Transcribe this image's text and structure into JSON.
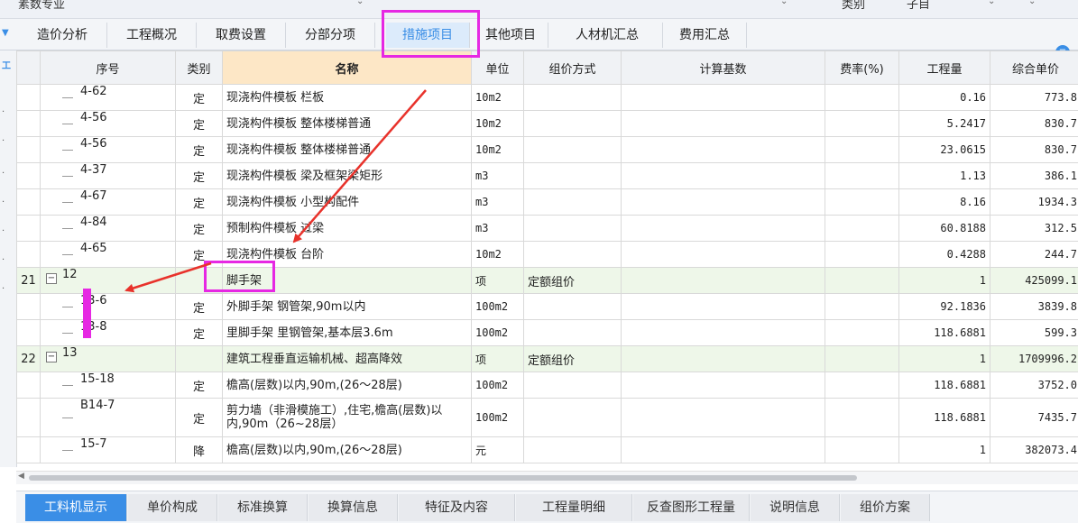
{
  "topbar": {
    "left": "素数专业",
    "mid": "类别",
    "right": "子目"
  },
  "tabs": [
    {
      "label": "造价分析"
    },
    {
      "label": "工程概况"
    },
    {
      "label": "取费设置"
    },
    {
      "label": "分部分项"
    },
    {
      "label": "措施项目"
    },
    {
      "label": "其他项目"
    },
    {
      "label": "人材机汇总"
    },
    {
      "label": "费用汇总"
    }
  ],
  "active_tab": "措施项目",
  "info_icon": "info-icon",
  "headers": [
    "序号",
    "类别",
    "名称",
    "单位",
    "组价方式",
    "计算基数",
    "费率(%)",
    "工程量",
    "综合单价"
  ],
  "rows": [
    {
      "idx": "",
      "code": "4-62",
      "type": "定",
      "name": "现浇构件模板 栏板",
      "unit": "10m2",
      "method": "",
      "base": "",
      "rate": "",
      "qty": "0.16",
      "price": "773.8"
    },
    {
      "idx": "",
      "code": "4-56",
      "type": "定",
      "name": "现浇构件模板 整体楼梯普通",
      "unit": "10m2",
      "method": "",
      "base": "",
      "rate": "",
      "qty": "5.2417",
      "price": "830.7"
    },
    {
      "idx": "",
      "code": "4-56",
      "type": "定",
      "name": "现浇构件模板 整体楼梯普通",
      "unit": "10m2",
      "method": "",
      "base": "",
      "rate": "",
      "qty": "23.0615",
      "price": "830.7"
    },
    {
      "idx": "",
      "code": "4-37",
      "type": "定",
      "name": "现浇构件模板 梁及框架梁矩形",
      "unit": "m3",
      "method": "",
      "base": "",
      "rate": "",
      "qty": "1.13",
      "price": "386.1"
    },
    {
      "idx": "",
      "code": "4-67",
      "type": "定",
      "name": "现浇构件模板 小型构配件",
      "unit": "m3",
      "method": "",
      "base": "",
      "rate": "",
      "qty": "8.16",
      "price": "1934.3"
    },
    {
      "idx": "",
      "code": "4-84",
      "type": "定",
      "name": "预制构件模板 过梁",
      "unit": "m3",
      "method": "",
      "base": "",
      "rate": "",
      "qty": "60.8188",
      "price": "312.5"
    },
    {
      "idx": "",
      "code": "4-65",
      "type": "定",
      "name": "现浇构件模板 台阶",
      "unit": "10m2",
      "method": "",
      "base": "",
      "rate": "",
      "qty": "0.4288",
      "price": "244.7"
    },
    {
      "idx": "21",
      "code": "12",
      "type": "",
      "name": "脚手架",
      "unit": "项",
      "method": "定额组价",
      "base": "",
      "rate": "",
      "qty": "1",
      "price": "425099.1",
      "group": true
    },
    {
      "idx": "",
      "code": "13-6",
      "type": "定",
      "name": "外脚手架 钢管架,90m以内",
      "unit": "100m2",
      "method": "",
      "base": "",
      "rate": "",
      "qty": "92.1836",
      "price": "3839.8"
    },
    {
      "idx": "",
      "code": "13-8",
      "type": "定",
      "name": "里脚手架 里钢管架,基本层3.6m",
      "unit": "100m2",
      "method": "",
      "base": "",
      "rate": "",
      "qty": "118.6881",
      "price": "599.3"
    },
    {
      "idx": "22",
      "code": "13",
      "type": "",
      "name": "建筑工程垂直运输机械、超高降效",
      "unit": "项",
      "method": "定额组价",
      "base": "",
      "rate": "",
      "qty": "1",
      "price": "1709996.2",
      "group": true
    },
    {
      "idx": "",
      "code": "15-18",
      "type": "定",
      "name": "檐高(层数)以内,90m,(26～28层)",
      "unit": "100m2",
      "method": "",
      "base": "",
      "rate": "",
      "qty": "118.6881",
      "price": "3752.0"
    },
    {
      "idx": "",
      "code": "B14-7",
      "type": "定",
      "name": "剪力墙（非滑模施工）,住宅,檐高(层数)以内,90m（26~28层）",
      "unit": "100m2",
      "method": "",
      "base": "",
      "rate": "",
      "qty": "118.6881",
      "price": "7435.7",
      "tall": true
    },
    {
      "idx": "",
      "code": "15-7",
      "type": "降",
      "name": "檐高(层数)以内,90m,(26～28层)",
      "unit": "元",
      "method": "",
      "base": "",
      "rate": "",
      "qty": "1",
      "price": "382073.4"
    }
  ],
  "bottom_tabs": [
    {
      "label": "工料机显示"
    },
    {
      "label": "单价构成"
    },
    {
      "label": "标准换算"
    },
    {
      "label": "换算信息"
    },
    {
      "label": "特征及内容"
    },
    {
      "label": "工程量明细"
    },
    {
      "label": "反查图形工程量"
    },
    {
      "label": "说明信息"
    },
    {
      "label": "组价方案"
    }
  ],
  "active_bottom_tab": "工料机显示",
  "colors": {
    "accent": "#3a8ee6",
    "annotation": "#e628e3",
    "arrow": "#e8322b",
    "group_row": "#eef7e9",
    "name_header": "#fde7c6"
  }
}
